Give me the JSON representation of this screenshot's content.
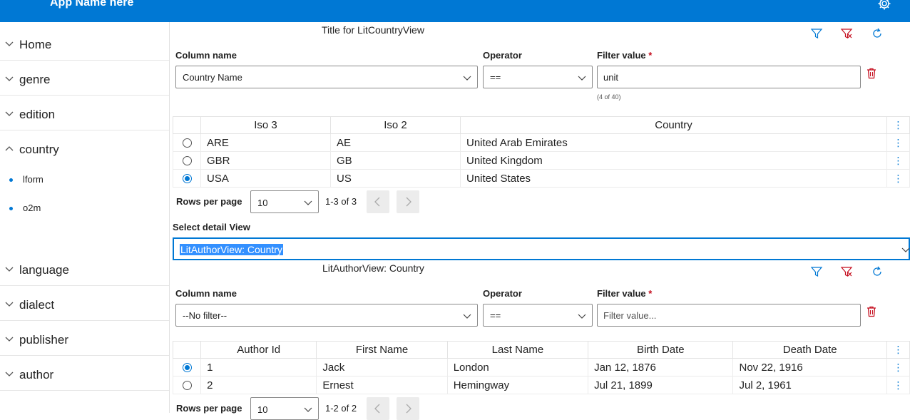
{
  "app": {
    "title": "App Name here"
  },
  "sidebar": {
    "items": [
      {
        "label": "Home"
      },
      {
        "label": "genre"
      },
      {
        "label": "edition"
      },
      {
        "label": "country"
      },
      {
        "label": "language"
      },
      {
        "label": "dialect"
      },
      {
        "label": "publisher"
      },
      {
        "label": "author"
      }
    ],
    "country_subitems": [
      {
        "label": "lform"
      },
      {
        "label": "o2m"
      }
    ]
  },
  "country_view": {
    "title": "Title for LitCountryView",
    "filter": {
      "column_label": "Column name",
      "column_value": "Country Name",
      "operator_label": "Operator",
      "operator_value": "==",
      "value_label": "Filter value",
      "required_mark": "*",
      "value": "unit",
      "match_hint": "(4 of 40)"
    },
    "table": {
      "columns": [
        "Iso 3",
        "Iso 2",
        "Country"
      ],
      "rows": [
        {
          "selected": false,
          "cells": [
            "ARE",
            "AE",
            "United Arab Emirates"
          ]
        },
        {
          "selected": false,
          "cells": [
            "GBR",
            "GB",
            "United Kingdom"
          ]
        },
        {
          "selected": true,
          "cells": [
            "USA",
            "US",
            "United States"
          ]
        }
      ],
      "menu_glyph": "⋮"
    },
    "pager": {
      "rows_per_page_label": "Rows per page",
      "rows_per_page": "10",
      "range": "1-3 of 3"
    }
  },
  "detail": {
    "label": "Select detail View",
    "selected": "LitAuthorView: Country"
  },
  "author_view": {
    "title": "LitAuthorView: Country",
    "filter": {
      "column_label": "Column name",
      "column_value": "--No filter--",
      "operator_label": "Operator",
      "operator_value": "==",
      "value_label": "Filter value",
      "required_mark": "*",
      "placeholder": "Filter value..."
    },
    "table": {
      "columns": [
        "Author Id",
        "First Name",
        "Last Name",
        "Birth Date",
        "Death Date"
      ],
      "rows": [
        {
          "selected": true,
          "cells": [
            "1",
            "Jack",
            "London",
            "Jan 12, 1876",
            "Nov 22, 1916"
          ]
        },
        {
          "selected": false,
          "cells": [
            "2",
            "Ernest",
            "Hemingway",
            "Jul 21, 1899",
            "Jul 2, 1961"
          ]
        }
      ],
      "menu_glyph": "⋮"
    },
    "pager": {
      "rows_per_page_label": "Rows per page",
      "rows_per_page": "10",
      "range": "1-2 of 2"
    }
  },
  "colors": {
    "accent": "#0078d4",
    "danger": "#c50f1f",
    "header": "#0078d4"
  }
}
